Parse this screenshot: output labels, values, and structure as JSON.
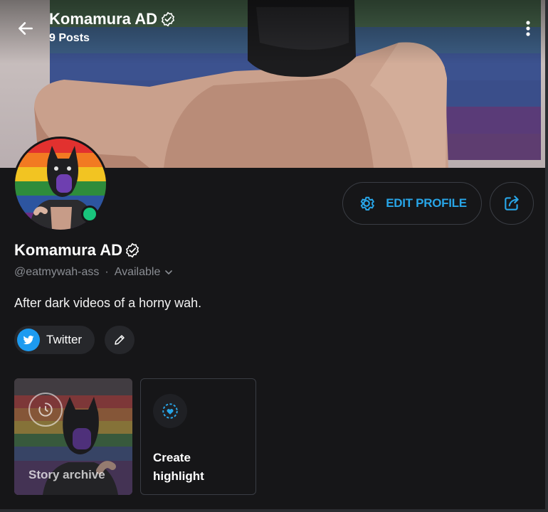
{
  "header": {
    "title": "Komamura AD",
    "posts": "9 Posts"
  },
  "profile": {
    "name": "Komamura AD",
    "handle": "@eatmywah-ass",
    "separator": "·",
    "status": "Available",
    "bio": "After dark videos of a horny wah.",
    "online": true
  },
  "actions": {
    "edit_label": "EDIT PROFILE"
  },
  "links": {
    "twitter_label": "Twitter"
  },
  "highlights": {
    "archive_label": "Story archive",
    "create_label": "Create highlight"
  },
  "colors": {
    "accent": "#28a5e7",
    "background": "#161618",
    "online": "#19c47c",
    "twitter": "#1d9bf0",
    "flag": [
      "#e2312f",
      "#f27a22",
      "#f2c422",
      "#2e8c3b",
      "#2d55a0",
      "#6a2f85"
    ]
  },
  "icons": {
    "back": "arrow-left-icon",
    "more": "more-vertical-icon",
    "verified": "verified-badge-icon",
    "settings": "gear-icon",
    "share": "share-icon",
    "chevron": "chevron-down-icon",
    "twitter": "twitter-bird-icon",
    "edit": "pencil-icon",
    "archive": "clock-icon",
    "create": "heart-plus-icon"
  }
}
